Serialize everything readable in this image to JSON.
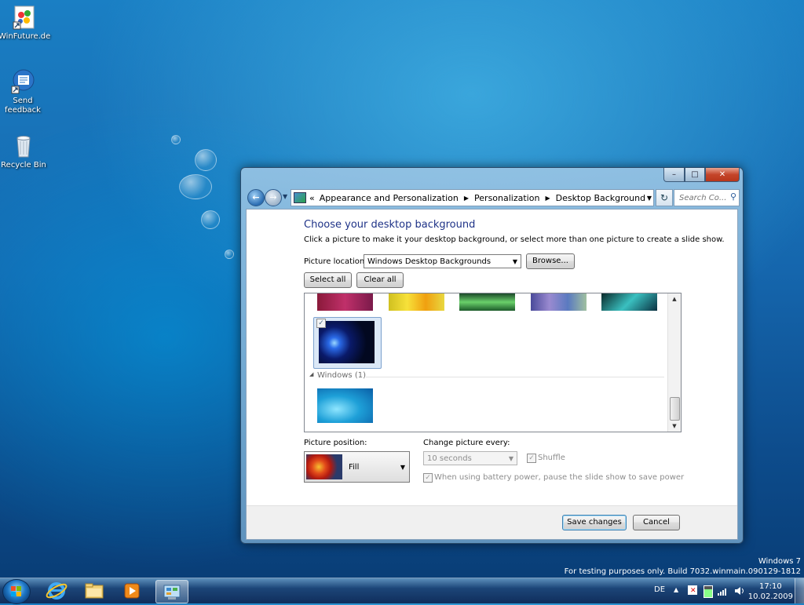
{
  "desktop": {
    "icons": [
      {
        "label": "WinFuture.de"
      },
      {
        "label": "Send feedback"
      },
      {
        "label": "Recycle Bin"
      }
    ],
    "watermark": {
      "line1": "Windows 7",
      "line2": "For testing purposes only. Build 7032.winmain.090129-1812"
    }
  },
  "window": {
    "controls": {
      "minimize": "–",
      "maximize": "□",
      "close": "✕"
    },
    "breadcrumb": [
      "Appearance and Personalization",
      "Personalization",
      "Desktop Background"
    ],
    "breadcrumb_prefix": "«",
    "search_placeholder": "Search Co...",
    "title": "Choose your desktop background",
    "subtitle": "Click a picture to make it your desktop background, or select more than one picture to create a slide show.",
    "picture_location_label": "Picture location:",
    "picture_location_value": "Windows Desktop Backgrounds",
    "browse_label": "Browse...",
    "select_all_label": "Select all",
    "clear_all_label": "Clear all",
    "group_label": "Windows (1)",
    "picture_position_label": "Picture position:",
    "picture_position_value": "Fill",
    "change_every_label": "Change picture every:",
    "change_every_value": "10 seconds",
    "shuffle_label": "Shuffle",
    "battery_label": "When using battery power, pause the slide show to save power",
    "save_label": "Save changes",
    "cancel_label": "Cancel"
  },
  "taskbar": {
    "language": "DE",
    "time": "17:10",
    "date": "10.02.2009"
  }
}
